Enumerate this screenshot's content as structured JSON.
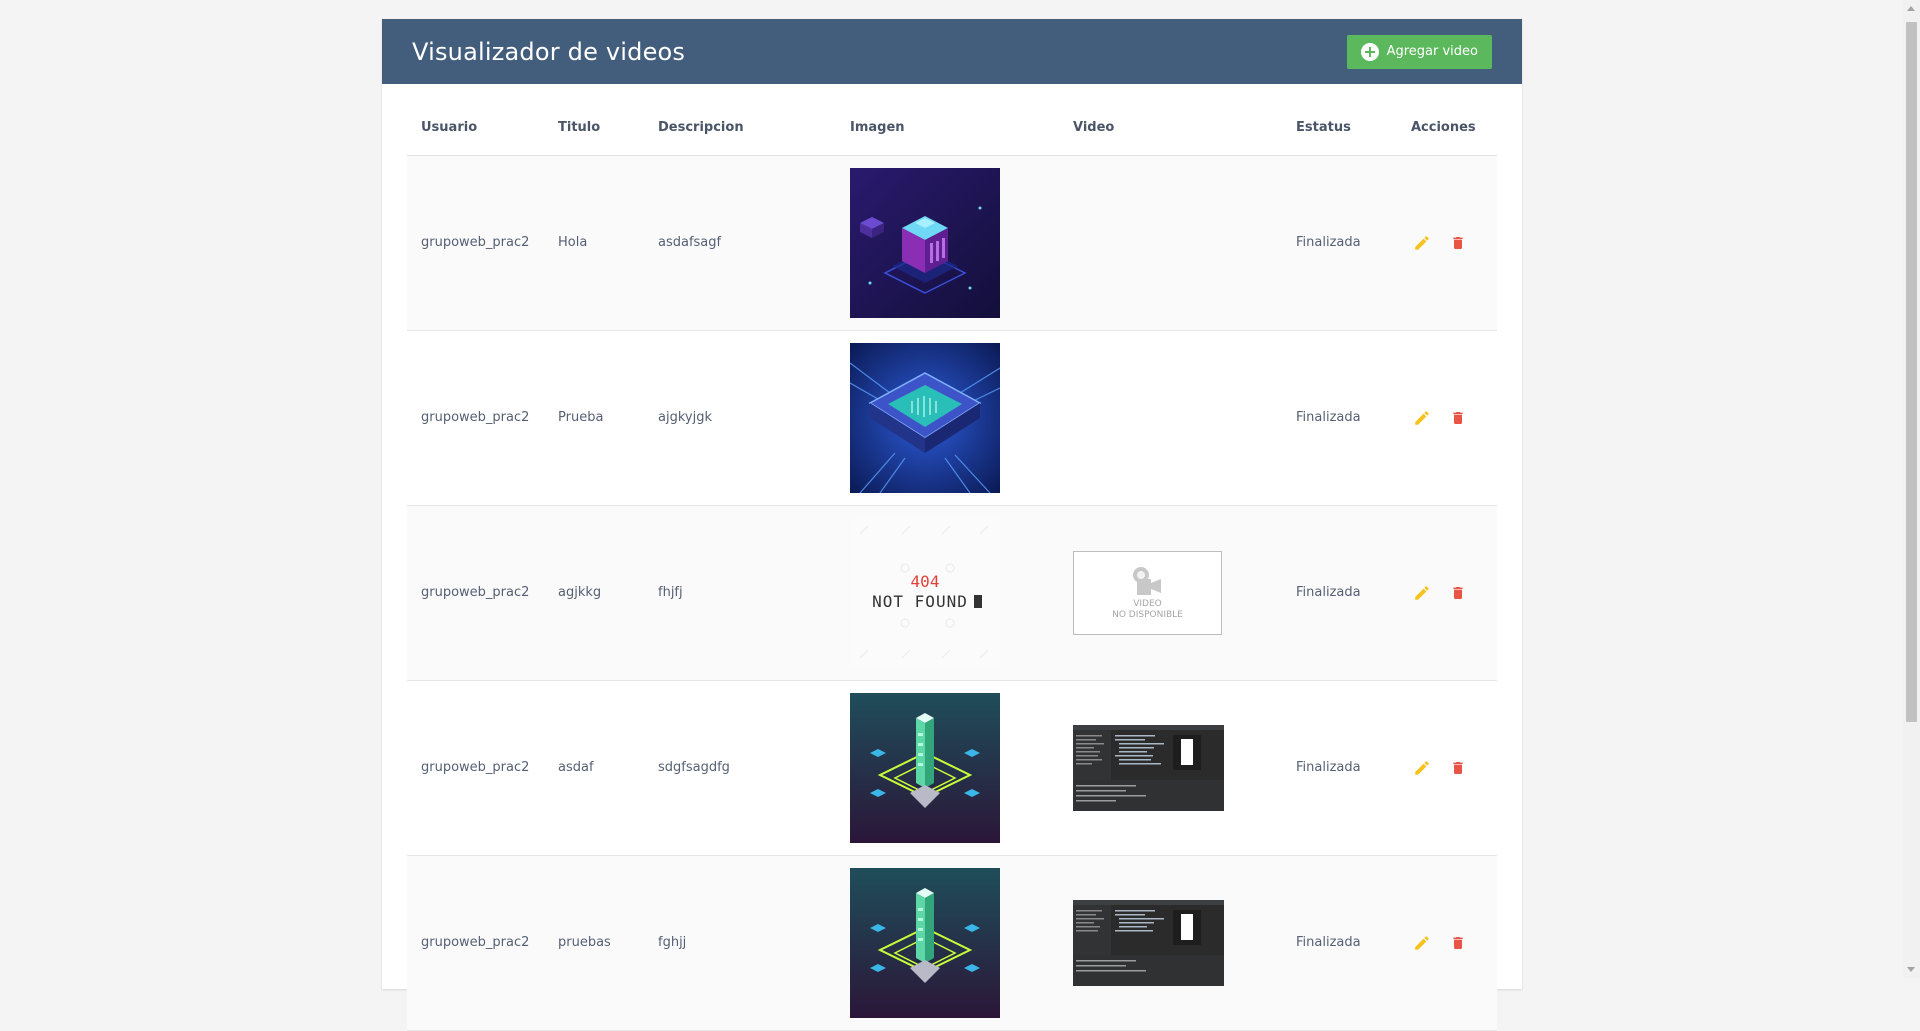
{
  "header": {
    "title": "Visualizador de videos",
    "add_button_label": "Agregar video",
    "background_color": "#435d7d",
    "add_button_color": "#5cb85c"
  },
  "table": {
    "columns": [
      "Usuario",
      "Titulo",
      "Descripcion",
      "Imagen",
      "Video",
      "Estatus",
      "Acciones"
    ],
    "rows": [
      {
        "usuario": "grupoweb_prac2",
        "titulo": "Hola",
        "descripcion": "asdafsagf",
        "imagen": "isometric-cube-image",
        "video": "",
        "estatus": "Finalizada"
      },
      {
        "usuario": "grupoweb_prac2",
        "titulo": "Prueba",
        "descripcion": "ajgkyjgk",
        "imagen": "cpu-chip-image",
        "video": "",
        "estatus": "Finalizada"
      },
      {
        "usuario": "grupoweb_prac2",
        "titulo": "agjkkg",
        "descripcion": "fhjfj",
        "imagen": "not-found-image",
        "video": "video-not-available",
        "estatus": "Finalizada"
      },
      {
        "usuario": "grupoweb_prac2",
        "titulo": "asdaf",
        "descripcion": "sdgfsagdfg",
        "imagen": "isometric-tower-image",
        "video": "code-editor-screenshot",
        "estatus": "Finalizada"
      },
      {
        "usuario": "grupoweb_prac2",
        "titulo": "pruebas",
        "descripcion": "fghjj",
        "imagen": "isometric-tower-image",
        "video": "code-editor-screenshot",
        "estatus": "Finalizada"
      }
    ]
  },
  "not_found_image": {
    "code": "404",
    "text": "NOT FOUND"
  },
  "video_unavailable": {
    "line1": "VIDEO",
    "line2": "NO DISPONIBLE"
  },
  "icons": {
    "edit": "pencil-icon",
    "delete": "trash-icon",
    "add": "plus-circle-icon"
  },
  "colors": {
    "edit_icon": "#f6c21b",
    "delete_icon": "#e85446"
  }
}
